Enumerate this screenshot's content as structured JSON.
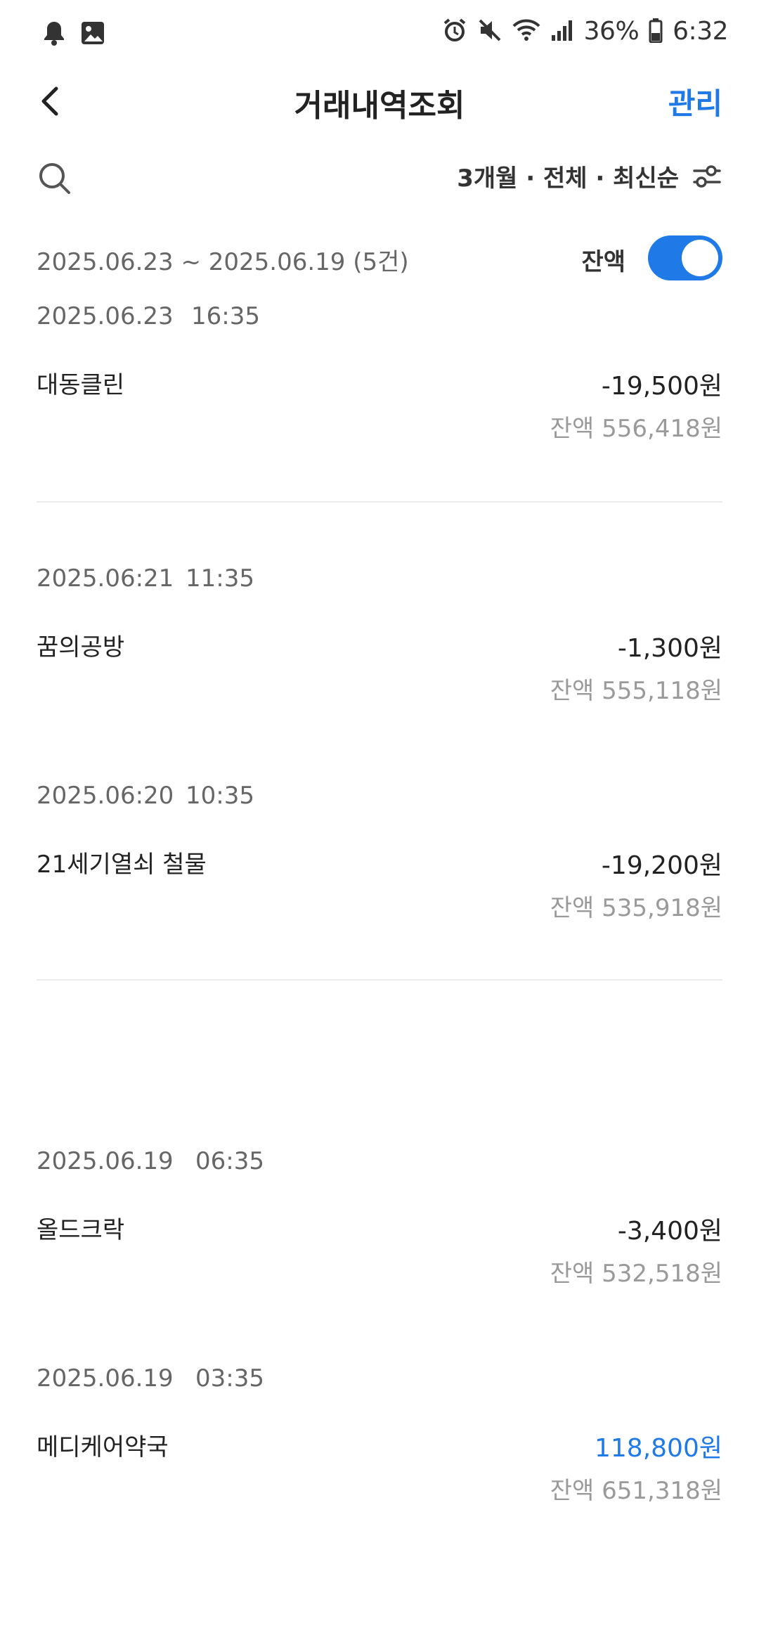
{
  "status_bar": {
    "battery_text": "36%",
    "time": "6:32",
    "icons": [
      "bell-icon",
      "image-icon",
      "alarm-icon",
      "mute-icon",
      "wifi-icon",
      "signal-icon",
      "battery-icon"
    ]
  },
  "header": {
    "title": "거래내역조회",
    "manage_label": "관리"
  },
  "filter": {
    "label": "3개월 · 전체 · 최신순"
  },
  "summary": {
    "range": "2025.06.23 ~ 2025.06.19 (5건)",
    "balance_label": "잔액",
    "balance_toggle_on": true
  },
  "transactions": [
    {
      "date": "2025.06.23",
      "time": "16:35",
      "merchant": "대동클린",
      "amount": "-19,500원",
      "balance": "잔액 556,418원",
      "positive": false
    },
    {
      "date": "2025.06:21",
      "time": "11:35",
      "merchant": "꿈의공방",
      "amount": "-1,300원",
      "balance": "잔액 555,118원",
      "positive": false
    },
    {
      "date": "2025.06:20",
      "time": "10:35",
      "merchant": "21세기열쇠 철물",
      "amount": "-19,200원",
      "balance": "잔액 535,918원",
      "positive": false
    },
    {
      "date": "2025.06.19",
      "time": "06:35",
      "merchant": "올드크락",
      "amount": "-3,400원",
      "balance": "잔액 532,518원",
      "positive": false
    },
    {
      "date": "2025.06.19",
      "time": "03:35",
      "merchant": "메디케어약국",
      "amount": "118,800원",
      "balance": "잔액 651,318원",
      "positive": true
    }
  ],
  "colors": {
    "accent": "#1f7ae8",
    "text": "#222222",
    "muted": "#9a9a9a"
  }
}
